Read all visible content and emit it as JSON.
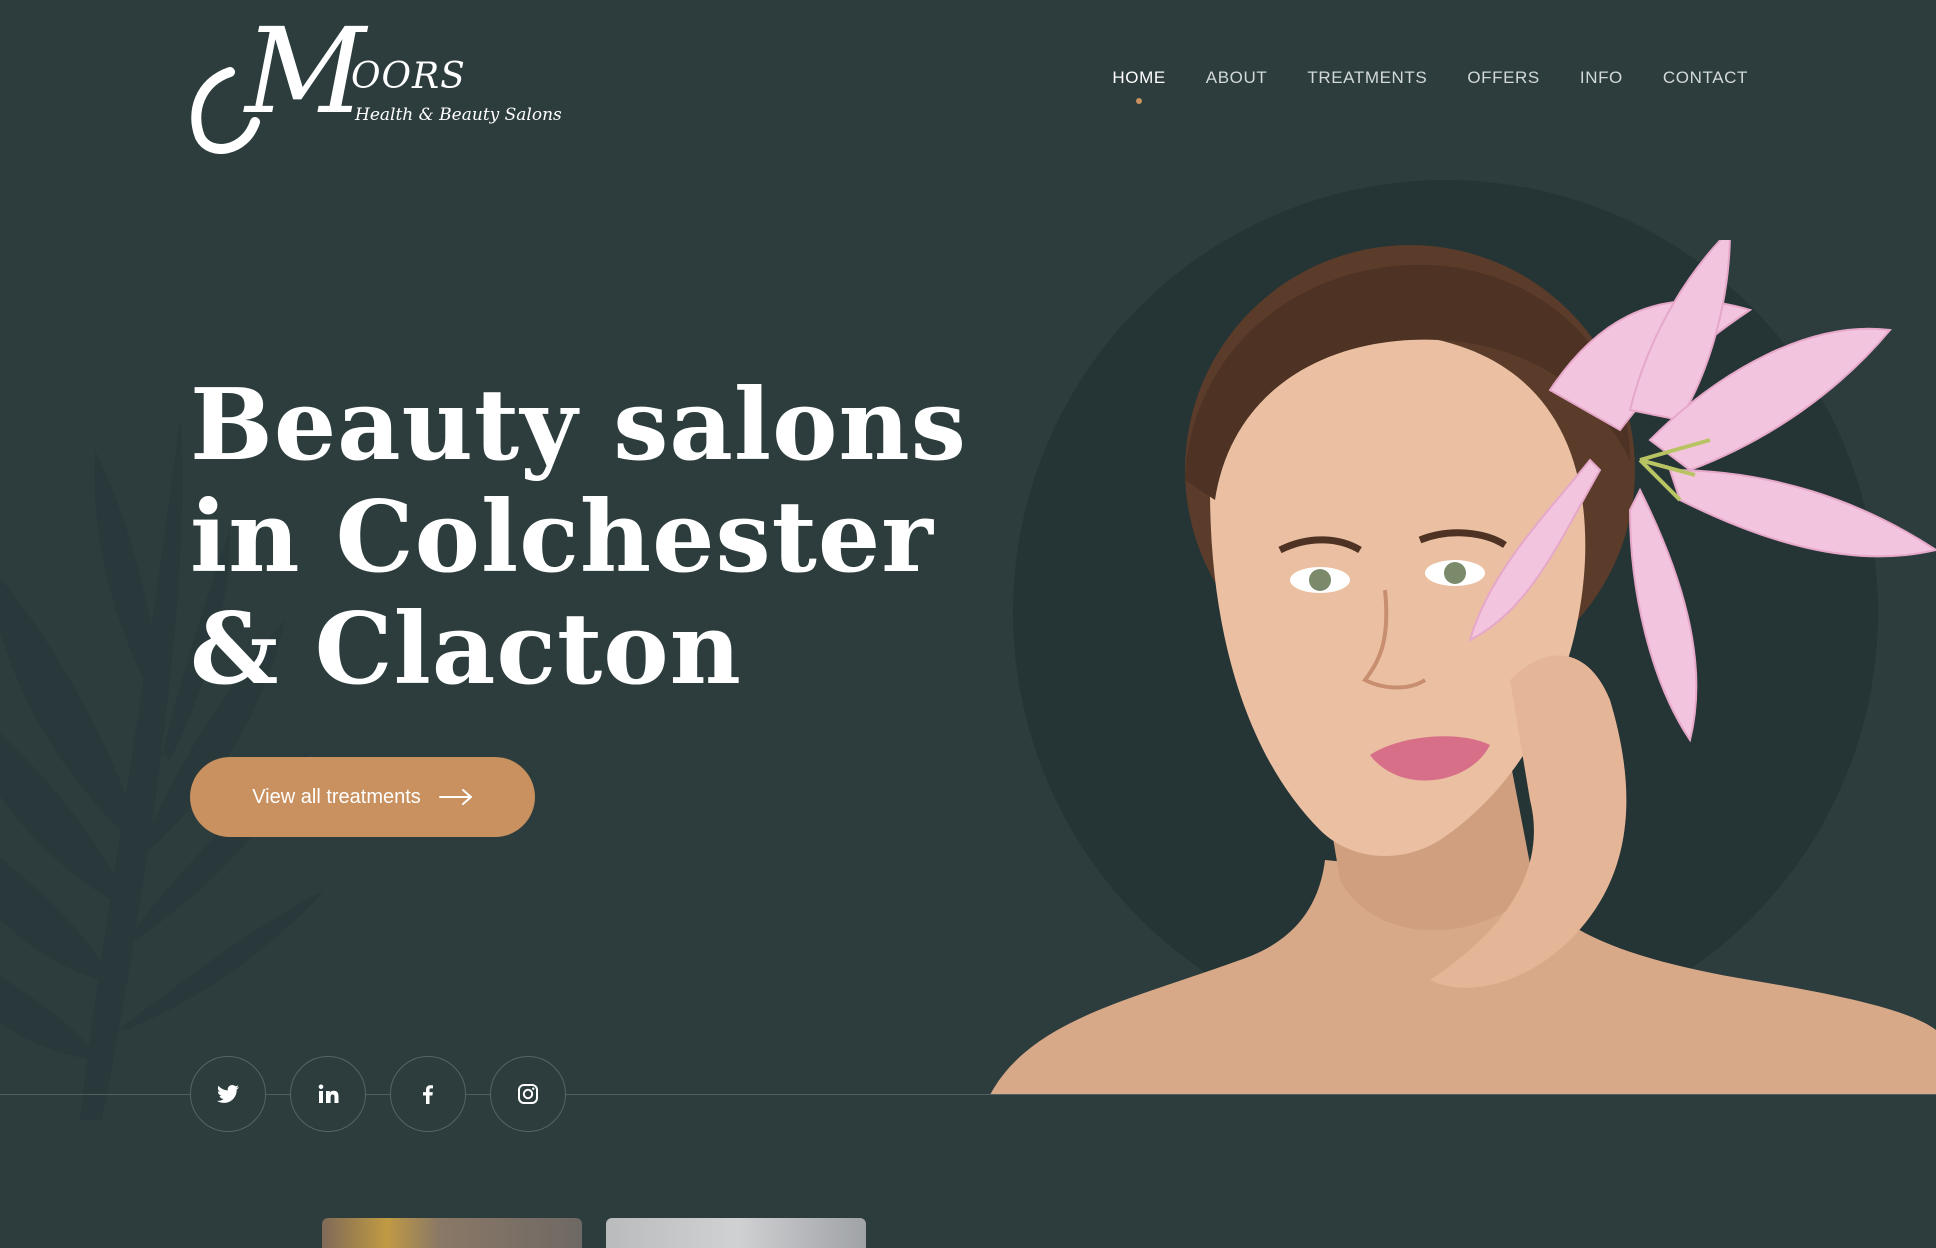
{
  "brand": {
    "logo_initial": "M",
    "logo_word": "OORS",
    "tagline": "Health & Beauty Salons"
  },
  "nav": {
    "items": [
      {
        "label": "HOME",
        "active": true
      },
      {
        "label": "ABOUT",
        "active": false
      },
      {
        "label": "TREATMENTS",
        "active": false
      },
      {
        "label": "OFFERS",
        "active": false
      },
      {
        "label": "INFO",
        "active": false
      },
      {
        "label": "CONTACT",
        "active": false
      }
    ]
  },
  "hero": {
    "title_lines": [
      "Beauty salons",
      "in Colchester",
      "& Clacton"
    ],
    "cta_label": "View all treatments"
  },
  "social": {
    "icons": [
      "twitter-icon",
      "linkedin-icon",
      "facebook-icon",
      "instagram-icon"
    ]
  },
  "colors": {
    "background": "#2d3d3e",
    "circle": "#253435",
    "accent": "#c8915f"
  }
}
